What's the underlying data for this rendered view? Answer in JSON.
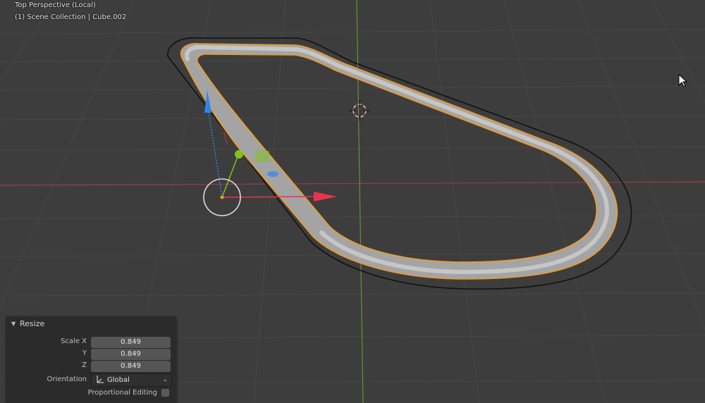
{
  "viewport": {
    "title": "Top Perspective (Local)",
    "collection": "(1) Scene Collection | Cube.002"
  },
  "resize_panel": {
    "title": "Resize",
    "scale_x_label": "Scale X",
    "scale_y_label": "Y",
    "scale_z_label": "Z",
    "scale_x": "0.849",
    "scale_y": "0.849",
    "scale_z": "0.849",
    "orientation_label": "Orientation",
    "orientation_value": "Global",
    "proportional_editing_label": "Proportional Editing",
    "proportional_editing": false
  },
  "colors": {
    "background": "#3d3d3d",
    "grid": "#474747",
    "x_axis": "#9b3b4a",
    "y_axis": "#6f8f2a",
    "selection_outline": "#f29b1e",
    "gizmo_x": "#e8344e",
    "gizmo_y": "#7dc31f",
    "gizmo_z": "#2f86e8",
    "panel_bg": "#2b2b2b"
  },
  "icons": {
    "cursor": "3d-cursor-icon",
    "pointer": "mouse-pointer-icon",
    "orientation": "orientation-global-icon",
    "collapse": "disclosure-triangle-icon"
  }
}
